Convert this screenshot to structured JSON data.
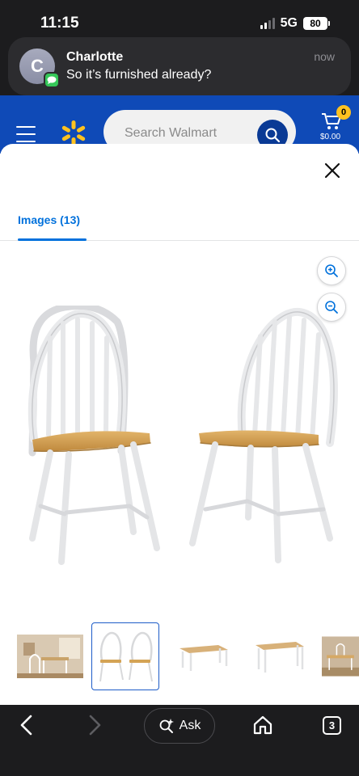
{
  "status_bar": {
    "time": "11:15",
    "network": "5G",
    "battery": "80"
  },
  "notification": {
    "avatar_initial": "C",
    "sender": "Charlotte",
    "message": "So it’s furnished already?",
    "time": "now"
  },
  "walmart_header": {
    "search_placeholder": "Search Walmart",
    "cart_count": "0",
    "cart_total": "$0.00",
    "brand_color": "#0f4ab7",
    "spark_color": "#ffc220"
  },
  "sheet": {
    "tabs": [
      {
        "label": "Images (13)",
        "active": true
      }
    ],
    "main_image": {
      "subject": "two white windsor chairs with natural wood seats"
    },
    "thumbnails": [
      {
        "subject": "dining room scene",
        "selected": false
      },
      {
        "subject": "two chairs",
        "selected": true
      },
      {
        "subject": "bench",
        "selected": false
      },
      {
        "subject": "table",
        "selected": false
      },
      {
        "subject": "dining set",
        "selected": false
      }
    ]
  },
  "toolbar": {
    "ask_label": "Ask",
    "tab_count": "3"
  }
}
